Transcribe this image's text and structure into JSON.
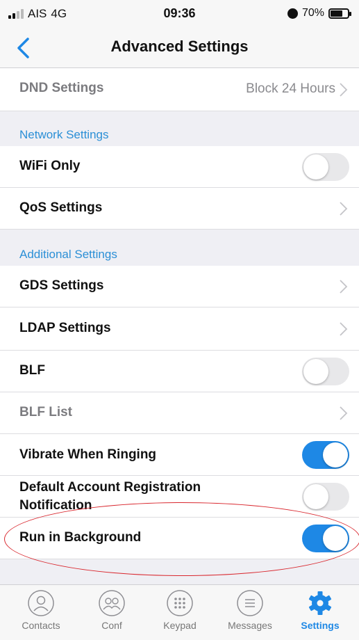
{
  "status_bar": {
    "carrier": "AIS",
    "network": "4G",
    "time": "09:36",
    "battery_text": "70%",
    "battery_level": 0.7
  },
  "nav": {
    "title": "Advanced Settings"
  },
  "rows": {
    "dnd": {
      "label": "DND Settings",
      "value": "Block 24 Hours"
    },
    "wifi_only": {
      "label": "WiFi Only",
      "on": false
    },
    "qos": {
      "label": "QoS Settings"
    },
    "gds": {
      "label": "GDS Settings"
    },
    "ldap": {
      "label": "LDAP Settings"
    },
    "blf": {
      "label": "BLF",
      "on": false
    },
    "blf_list": {
      "label": "BLF List"
    },
    "vibrate": {
      "label": "Vibrate When Ringing",
      "on": true
    },
    "default_account_line1": "Default Account Registration",
    "default_account_line2": "Notification",
    "default_account_on": false,
    "run_in_background": {
      "label": "Run in Background",
      "on": true
    }
  },
  "sections": {
    "network": "Network Settings",
    "additional": "Additional Settings"
  },
  "tabs": {
    "contacts": "Contacts",
    "conf": "Conf",
    "keypad": "Keypad",
    "messages": "Messages",
    "settings": "Settings"
  },
  "colors": {
    "accent": "#1e88e5",
    "section_header": "#2b8fd6",
    "annotation": "#d9272e"
  }
}
